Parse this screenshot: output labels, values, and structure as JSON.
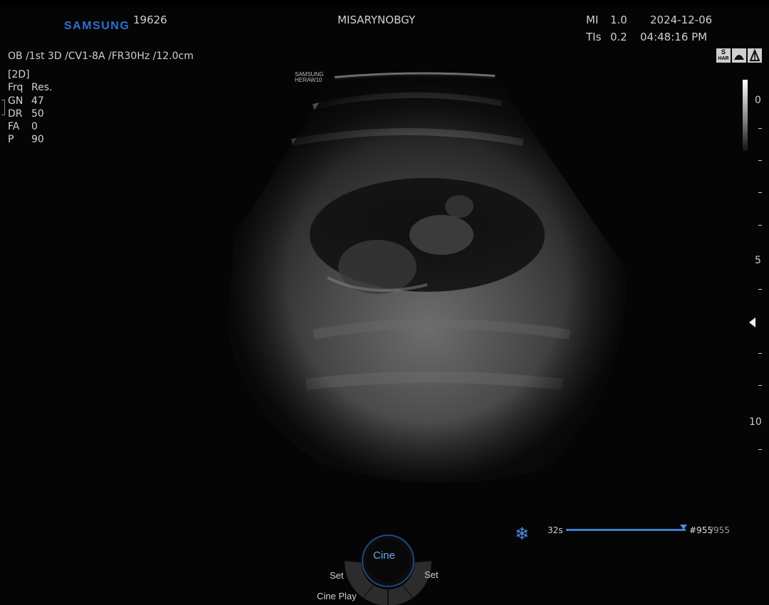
{
  "header": {
    "brand": "SAMSUNG",
    "patient_id": "19626",
    "institution": "MISARYNOBGY",
    "mi_label": "MI",
    "mi_value": "1.0",
    "tis_label": "TIs",
    "tis_value": "0.2",
    "date": "2024-12-06",
    "time": "04:48:16 PM",
    "exam_line": "OB /1st 3D /CV1-8A /FR30Hz /12.0cm"
  },
  "params": {
    "mode": "[2D]",
    "rows": [
      {
        "label": "Frq",
        "value": "Res."
      },
      {
        "label": "GN",
        "value": "47"
      },
      {
        "label": "DR",
        "value": "50"
      },
      {
        "label": "FA",
        "value": "0"
      },
      {
        "label": "P",
        "value": "90"
      }
    ]
  },
  "watermark": {
    "line1": "SAMSUNG",
    "line2": "HERAW10"
  },
  "mode_icons": [
    {
      "name": "s-har-icon",
      "top": "S",
      "bottom": "HAR"
    },
    {
      "name": "probe-orientation-icon"
    },
    {
      "name": "lateral-icon"
    }
  ],
  "depth_scale": {
    "labels": [
      "0",
      "5",
      "10"
    ]
  },
  "cine": {
    "duration": "32s",
    "frame_current": "#955",
    "frame_total": "/955",
    "progress": 1.0,
    "freeze_icon": "snowflake-icon",
    "center_label": "Cine",
    "left_label": "Set",
    "right_label": "Set",
    "bottom_label": "Cine Play"
  },
  "colors": {
    "brand": "#2f6fd0",
    "accent": "#4b8ce0",
    "background": "#050505"
  }
}
